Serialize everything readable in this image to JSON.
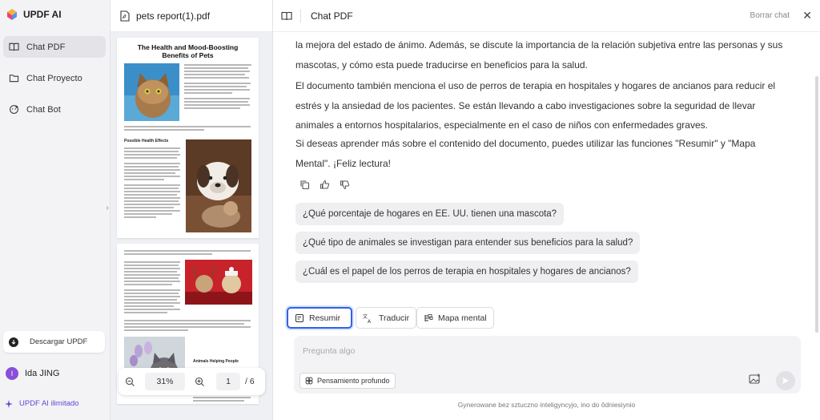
{
  "app": {
    "name": "UPDF AI"
  },
  "sidebar": {
    "items": [
      {
        "label": "Chat PDF",
        "icon": "book-icon",
        "active": true
      },
      {
        "label": "Chat Proyecto",
        "icon": "folder-icon",
        "active": false
      },
      {
        "label": "Chat Bot",
        "icon": "bot-icon",
        "active": false
      }
    ],
    "download_label": "Descargar UPDF",
    "user": {
      "initial": "I",
      "name": "Ida JING"
    },
    "unlimited_label": "UPDF AI ilimitado"
  },
  "pdf": {
    "filename": "pets report(1).pdf",
    "page_title": "The Health and Mood-Boosting Benefits of Pets",
    "section1": "Possible Health Effects",
    "section2": "Animals Helping People",
    "zoom": "31%",
    "current_page": "1",
    "total_pages": "/ 6"
  },
  "chat": {
    "title": "Chat PDF",
    "clear_label": "Borrar chat",
    "paragraphs": [
      "la mejora del estado de ánimo. Además, se discute la importancia de la relación subjetiva entre las personas y sus mascotas, y cómo esta puede traducirse en beneficios para la salud.",
      "El documento también menciona el uso de perros de terapia en hospitales y hogares de ancianos para reducir el estrés y la ansiedad de los pacientes. Se están llevando a cabo investigaciones sobre la seguridad de llevar animales a entornos hospitalarios, especialmente en el caso de niños con enfermedades graves.",
      "Si deseas aprender más sobre el contenido del documento, puedes utilizar las funciones \"Resumir\" y \"Mapa Mental\". ¡Feliz lectura!"
    ],
    "suggestions": [
      "¿Qué porcentaje de hogares en EE. UU. tienen una mascota?",
      "¿Qué tipo de animales se investigan para entender sus beneficios para la salud?",
      "¿Cuál es el papel de los perros de terapia en hospitales y hogares de ancianos?"
    ],
    "tools": [
      {
        "label": "Resumir",
        "icon": "summarize-icon",
        "selected": true
      },
      {
        "label": "Traducir",
        "icon": "translate-icon",
        "selected": false
      },
      {
        "label": "Mapa mental",
        "icon": "mindmap-icon",
        "selected": false
      }
    ],
    "input_placeholder": "Pregunta algo",
    "deep_think_label": "Pensamiento profundo",
    "disclaimer": "Gynerowane bez sztuczno inteligyncyjo, ino do ôdniesiynio"
  },
  "colors": {
    "accent": "#2f62e6",
    "brand_purple": "#5b4bd8",
    "avatar": "#8a4fd8"
  }
}
